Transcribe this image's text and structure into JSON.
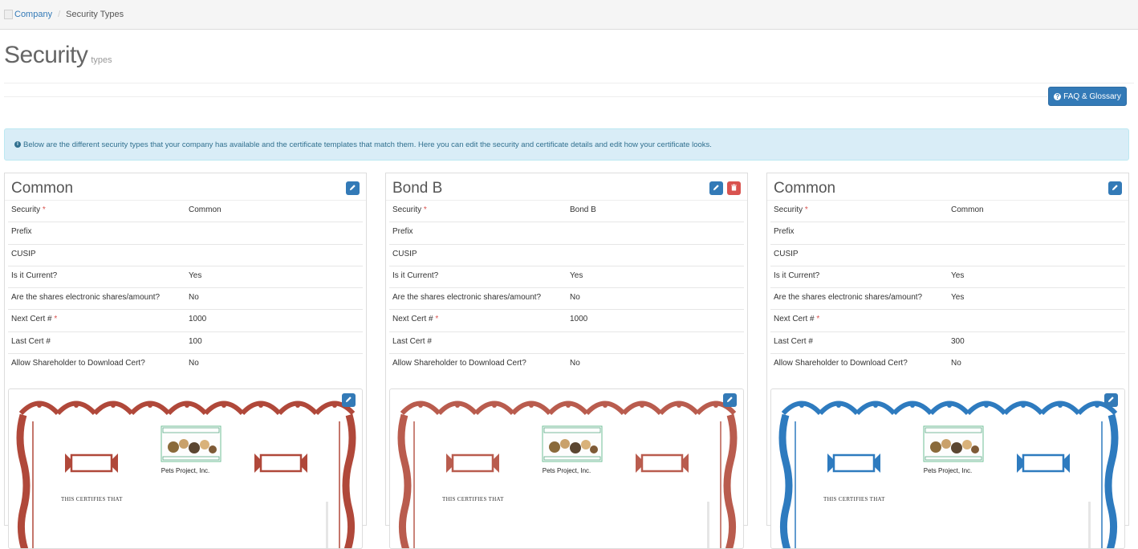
{
  "breadcrumb": {
    "company": "Company",
    "separator": "/",
    "current": "Security Types"
  },
  "page": {
    "title": "Security",
    "subtitle": "types"
  },
  "faq_button": {
    "label": "FAQ & Glossary"
  },
  "info": {
    "text": "Below are the different security types that your company has available and the certificate templates that match them. Here you can edit the security and certificate details and edit how your certificate looks."
  },
  "labels": {
    "security": "Security",
    "prefix": "Prefix",
    "cusip": "CUSIP",
    "is_current": "Is it Current?",
    "electronic": "Are the shares electronic shares/amount?",
    "next_cert": "Next Cert #",
    "last_cert": "Last Cert #",
    "allow_download": "Allow Shareholder to Download Cert?",
    "required_mark": "*"
  },
  "cards": [
    {
      "title": "Common",
      "security": "Common",
      "prefix": "",
      "cusip": "",
      "is_current": "Yes",
      "electronic": "No",
      "next_cert": "1000",
      "last_cert": "100",
      "allow_download": "No",
      "certificate": {
        "company": "Pets Project, Inc.",
        "certifies": "THIS CERTIFIES THAT",
        "border_color": "#b0483a"
      }
    },
    {
      "title": "Bond B",
      "security": "Bond B",
      "prefix": "",
      "cusip": "",
      "is_current": "Yes",
      "electronic": "No",
      "next_cert": "1000",
      "last_cert": "",
      "allow_download": "No",
      "certificate": {
        "company": "Pets Project, Inc.",
        "certifies": "THIS CERTIFIES THAT",
        "border_color": "#b95c4e"
      }
    },
    {
      "title": "Common",
      "security": "Common",
      "prefix": "",
      "cusip": "",
      "is_current": "Yes",
      "electronic": "Yes",
      "next_cert": "",
      "last_cert": "300",
      "allow_download": "No",
      "certificate": {
        "company": "Pets Project, Inc.",
        "certifies": "THIS CERTIFIES THAT",
        "border_color": "#2e7bbf"
      }
    }
  ],
  "colors": {
    "primary": "#337ab7",
    "danger": "#d9534f",
    "info_bg": "#d9edf7",
    "info_text": "#31708f"
  },
  "icons": {
    "edit": "pencil-icon",
    "delete": "trash-icon",
    "faq": "question-circle-icon",
    "info": "info-circle-icon"
  }
}
